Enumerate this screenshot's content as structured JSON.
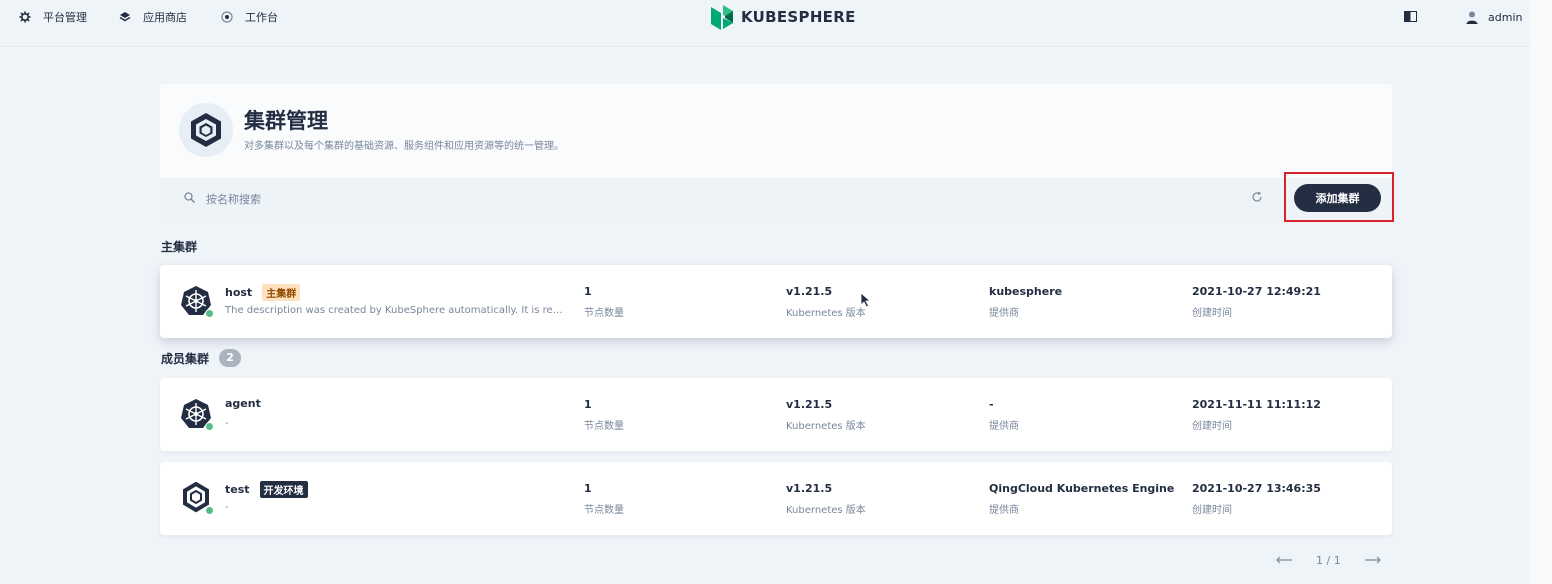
{
  "nav": {
    "items": [
      {
        "label": "平台管理",
        "icon": "gear-icon"
      },
      {
        "label": "应用商店",
        "icon": "layers-icon"
      },
      {
        "label": "工作台",
        "icon": "compass-icon"
      }
    ],
    "logo_text": "KUBESPHERE",
    "user": "admin"
  },
  "banner": {
    "title": "集群管理",
    "description": "对多集群以及每个集群的基础资源、服务组件和应用资源等的统一管理。",
    "search_placeholder": "按名称搜索",
    "add_button": "添加集群"
  },
  "sections": {
    "host": {
      "title": "主集群"
    },
    "member": {
      "title": "成员集群",
      "count": "2"
    }
  },
  "field_labels": {
    "nodes": "节点数量",
    "version": "Kubernetes 版本",
    "provider": "提供商",
    "created": "创建时间"
  },
  "clusters": [
    {
      "name": "host",
      "tag": "主集群",
      "description": "The description was created by KubeSphere automatically. It is recommended that you use the Host Cluster to manage clusters only and deploy workloads on Member Clusters.",
      "nodes": "1",
      "version": "v1.21.5",
      "provider": "kubesphere",
      "created": "2021-10-27 12:49:21",
      "status_color": "#55bc8a"
    },
    {
      "name": "agent",
      "tag": "",
      "description": "-",
      "nodes": "1",
      "version": "v1.21.5",
      "provider": "-",
      "created": "2021-11-11 11:11:12",
      "status_color": "#55bc8a"
    },
    {
      "name": "test",
      "tag": "开发环境",
      "description": "-",
      "nodes": "1",
      "version": "v1.21.5",
      "provider": "QingCloud Kubernetes Engine",
      "created": "2021-10-27 13:46:35",
      "status_color": "#55bc8a"
    }
  ],
  "pagination": {
    "current": "1 / 1"
  },
  "colors": {
    "background": "#eff4f9",
    "dark": "#242e42",
    "muted": "#79879c",
    "success": "#55bc8a",
    "highlight": "#d9222a",
    "logo_green": "#00aa72"
  }
}
